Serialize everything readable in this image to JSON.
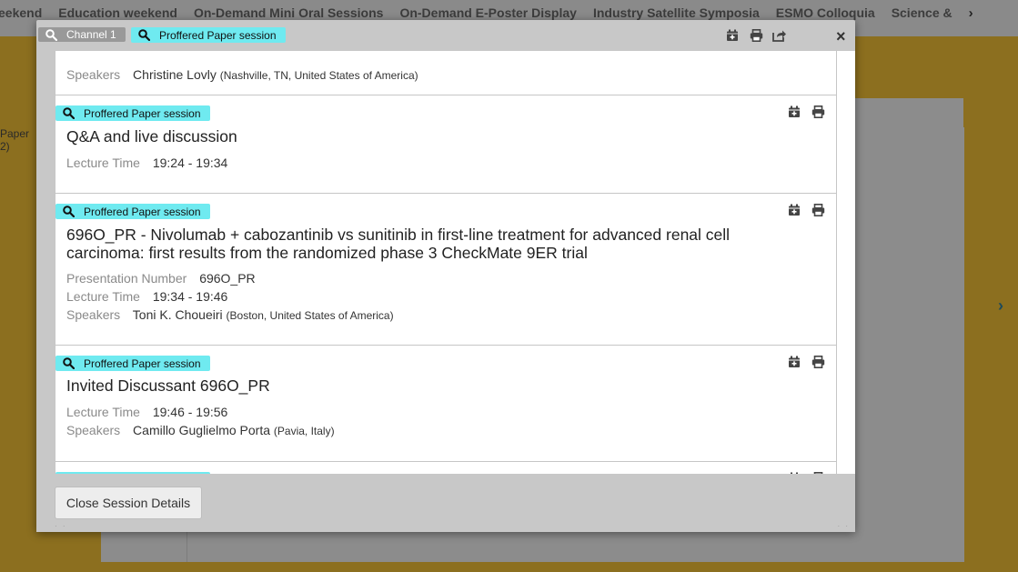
{
  "background": {
    "nav_items": [
      "eekend",
      "Education weekend",
      "On-Demand Mini Oral Sessions",
      "On-Demand E-Poster Display",
      "Industry Satellite Symposia",
      "ESMO Colloquia",
      "Science & "
    ],
    "side_text": [
      "Paper",
      "2)"
    ]
  },
  "modal": {
    "channel_chip": "Channel 1",
    "session_type_chip": "Proffered Paper session",
    "close_symbol": "×",
    "header_icons": [
      "calendar-add-icon",
      "print-icon",
      "share-icon"
    ]
  },
  "labels": {
    "presentation_number": "Presentation Number",
    "lecture_time": "Lecture Time",
    "speakers": "Speakers"
  },
  "sessions": [
    {
      "speaker": "Christine Lovly",
      "affiliation": "(Nashville, TN, United States of America)"
    },
    {
      "type": "Proffered Paper session",
      "title": "Q&A and live discussion",
      "lecture_time": "19:24 - 19:34"
    },
    {
      "type": "Proffered Paper session",
      "title_line1": "696O_PR - Nivolumab + cabozantinib vs sunitinib in first-line treatment for advanced renal cell",
      "title_line2": "carcinoma: first results from the randomized phase 3 CheckMate 9ER trial",
      "presentation_number": "696O_PR",
      "lecture_time": "19:34 - 19:46",
      "speaker": "Toni K. Choueiri",
      "affiliation": "(Boston, United States of America)"
    },
    {
      "type": "Proffered Paper session",
      "title": "Invited Discussant 696O_PR",
      "lecture_time": "19:46 - 19:56",
      "speaker": "Camillo Guglielmo Porta",
      "affiliation": "(Pavia, Italy)"
    },
    {
      "type": "Proffered Paper session"
    }
  ],
  "footer": {
    "close_button": "Close Session Details"
  },
  "colors": {
    "chip_cyan": "#6feaf0",
    "background_gold": "#8c6f1f"
  }
}
